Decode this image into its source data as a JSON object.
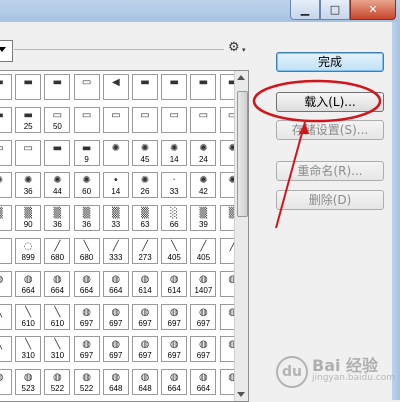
{
  "window": {
    "controls": [
      {
        "name": "minimize-button",
        "glyph": "▁"
      },
      {
        "name": "maximize-button",
        "glyph": "□"
      },
      {
        "name": "close-button",
        "glyph": "✕"
      }
    ]
  },
  "toolbar": {
    "gear_icon": "⚙",
    "gear_arrow": "▾"
  },
  "brushes": {
    "rows": [
      [
        "",
        "",
        "",
        "",
        "",
        "",
        "",
        "",
        ""
      ],
      [
        "",
        "25",
        "50",
        "",
        "",
        "",
        "",
        "",
        ""
      ],
      [
        "",
        "",
        "",
        "9",
        "",
        "45",
        "14",
        "24",
        ""
      ],
      [
        "",
        "36",
        "44",
        "60",
        "14",
        "26",
        "33",
        "42",
        ""
      ],
      [
        "",
        "90",
        "36",
        "36",
        "33",
        "63",
        "66",
        "39",
        ""
      ],
      [
        "",
        "899",
        "680",
        "680",
        "333",
        "273",
        "405",
        "405",
        ""
      ],
      [
        "",
        "664",
        "664",
        "664",
        "664",
        "614",
        "614",
        "1407",
        ""
      ],
      [
        "",
        "610",
        "610",
        "697",
        "697",
        "697",
        "697",
        "697",
        ""
      ],
      [
        "",
        "310",
        "310",
        "697",
        "697",
        "697",
        "697",
        "697",
        ""
      ],
      [
        "",
        "523",
        "522",
        "522",
        "648",
        "648",
        "664",
        "664",
        ""
      ]
    ],
    "glyphs": [
      [
        "▬",
        "▬",
        "▬",
        "▭",
        "◀",
        "▬",
        "▬",
        "▬",
        "▬"
      ],
      [
        "▬",
        "▬",
        "▭",
        "▭",
        "▭",
        "▭",
        "▭",
        "▭",
        "▭"
      ],
      [
        "▭",
        "▭",
        "▬",
        "▬",
        "✺",
        "✺",
        "✺",
        "✺",
        "✺"
      ],
      [
        "✺",
        "✺",
        "✺",
        "✺",
        "•",
        "✺",
        "·",
        "✺",
        "✺"
      ],
      [
        "▒",
        "▒",
        "▒",
        "▒",
        "▒",
        "▒",
        "░",
        "▒",
        "▒"
      ],
      [
        "·",
        "◌",
        "╱",
        "╲",
        "╱",
        "╱",
        "╲",
        "╱",
        "╱"
      ],
      [
        "◍",
        "◍",
        "◍",
        "◍",
        "◍",
        "◍",
        "◍",
        "◍",
        "◍"
      ],
      [
        "╲",
        "╲",
        "╲",
        "◍",
        "◍",
        "◍",
        "◍",
        "◍",
        "◍"
      ],
      [
        "╲",
        "╲",
        "╲",
        "◍",
        "◍",
        "◍",
        "◍",
        "◍",
        "◍"
      ],
      [
        "◍",
        "◍",
        "◍",
        "◍",
        "◍",
        "◍",
        "◍",
        "◍",
        "◍"
      ]
    ]
  },
  "buttons": {
    "done": "完成",
    "load": "载入(L)...",
    "save_set": "存储设置(S)...",
    "rename": "重命名(R)...",
    "delete": "删除(D)"
  },
  "watermark": {
    "icon": "du",
    "main": "Bai 经验",
    "sub": "jingyan.baidu.com"
  },
  "colors": {
    "annotation_red": "#d3141b",
    "primary_button": "#bfe0f6"
  }
}
